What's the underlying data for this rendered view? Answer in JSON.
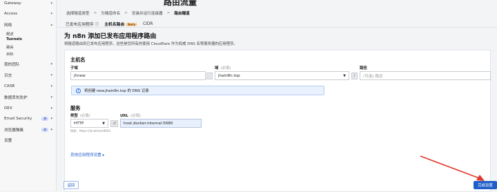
{
  "sidebar": {
    "items": [
      {
        "label": "Gateway"
      },
      {
        "label": "Access"
      },
      {
        "label": "网络"
      },
      {
        "label": "我的团队"
      },
      {
        "label": "日志"
      },
      {
        "label": "CASB"
      },
      {
        "label": "数据丢失防护"
      },
      {
        "label": "DEX"
      },
      {
        "label": "Email Security"
      },
      {
        "label": "浏览器隔离"
      },
      {
        "label": "设置"
      }
    ],
    "sub_items": [
      {
        "label": "概述"
      },
      {
        "label": "Tunnels"
      },
      {
        "label": "路由"
      },
      {
        "label": "目标"
      }
    ],
    "badge": "新"
  },
  "page": {
    "title": "路由流量",
    "steps": [
      "选择隧道类型",
      "为隧道命名",
      "安装并运行连接器",
      "路由隧道"
    ],
    "step_sep": ">",
    "tabs": [
      "已发布应用程序",
      "主机名路由",
      "CIDR"
    ],
    "tab_info_icon": "ⓘ",
    "beta": "Beta",
    "heading": "为 n8n 添加已发布应用程序路由",
    "description": "将隧道路由到已发布应用程序。这些是您所有的使用 Cloudflare 作为权威 DNS 名称服务器的应用程序。"
  },
  "hostname": {
    "section_title": "主机名",
    "subdomain_label": "子域",
    "optional": "(必填)",
    "subdomain_value": "jhnew",
    "domain_label": "域",
    "domain_required": "(必填)",
    "domain_value": "jhain8n.top",
    "dot": ".",
    "slash": "/",
    "path_label": "路径",
    "path_placeholder": "(可选) 路径",
    "info_text": "将创建 new.jhain8n.top 的 DNS 记录"
  },
  "service": {
    "section_title": "服务",
    "type_label": "类型",
    "type_required": "(必填)",
    "type_value": "HTTP",
    "sep": "://",
    "url_label": "URL",
    "url_required": "(必填)",
    "url_value": "host.docker.internal:5680",
    "hint": "例如：https://localhost:8001"
  },
  "other_settings_link": "其他应用程序设置 ▸",
  "buttons": {
    "back": "返回",
    "finish": "完成设置"
  },
  "colors": {
    "accent": "#1f5fc9",
    "annotation_arrow": "#e0362c"
  },
  "icons": {
    "info": "info-icon",
    "chevron": "chevron-down-icon"
  }
}
